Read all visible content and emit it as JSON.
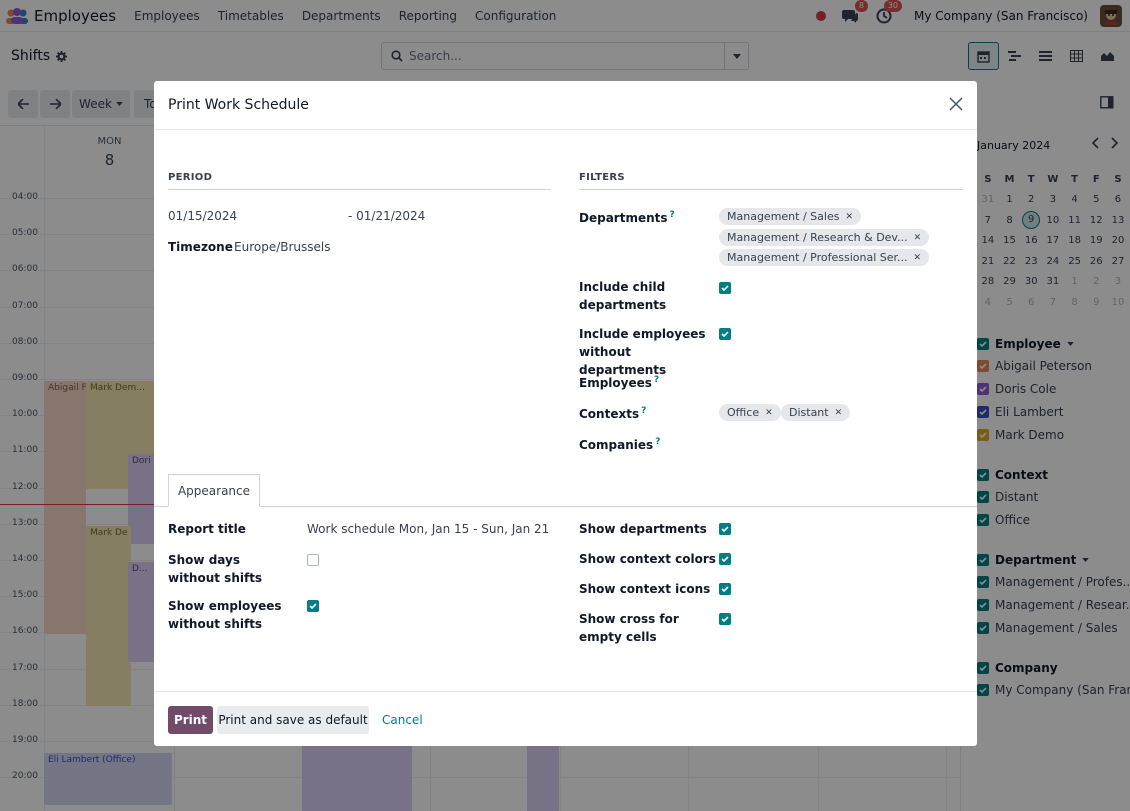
{
  "topbar": {
    "app_name": "Employees",
    "menu": [
      "Employees",
      "Timetables",
      "Departments",
      "Reporting",
      "Configuration"
    ],
    "messages_count": "8",
    "activities_count": "30",
    "company": "My Company (San Francisco)"
  },
  "control": {
    "breadcrumb": "Shifts",
    "search_placeholder": "Search..."
  },
  "toolbar": {
    "week_label": "Week",
    "today_label": "To"
  },
  "calendar": {
    "day_name": "MON",
    "day_num": "8",
    "hours": [
      "04:00",
      "05:00",
      "06:00",
      "07:00",
      "08:00",
      "09:00",
      "10:00",
      "11:00",
      "12:00",
      "13:00",
      "14:00",
      "15:00",
      "16:00",
      "17:00",
      "18:00",
      "19:00",
      "20:00"
    ],
    "events": [
      "Abigail F",
      "Mark Dem...",
      "Dori",
      "Mark De",
      "D...",
      "Eli Lambert (Office)"
    ]
  },
  "sidebar": {
    "month": "January 2024",
    "weekdays": [
      "S",
      "M",
      "T",
      "W",
      "T",
      "F",
      "S"
    ],
    "weeks": [
      [
        "31",
        "1",
        "2",
        "3",
        "4",
        "5",
        "6"
      ],
      [
        "7",
        "8",
        "9",
        "10",
        "11",
        "12",
        "13"
      ],
      [
        "14",
        "15",
        "16",
        "17",
        "18",
        "19",
        "20"
      ],
      [
        "21",
        "22",
        "23",
        "24",
        "25",
        "26",
        "27"
      ],
      [
        "28",
        "29",
        "30",
        "31",
        "1",
        "2",
        "3"
      ],
      [
        "4",
        "5",
        "6",
        "7",
        "8",
        "9",
        "10"
      ]
    ],
    "today": "9",
    "employee_title": "Employee",
    "employees": [
      {
        "name": "Abigail Peterson",
        "color": "#e8875a"
      },
      {
        "name": "Doris Cole",
        "color": "#8e5bd6"
      },
      {
        "name": "Eli Lambert",
        "color": "#3b4fc7"
      },
      {
        "name": "Mark Demo",
        "color": "#e0a92e"
      }
    ],
    "context_title": "Context",
    "contexts": [
      "Distant",
      "Office"
    ],
    "department_title": "Department",
    "departments": [
      "Management / Profes...",
      "Management / Resear...",
      "Management / Sales"
    ],
    "company_title": "Company",
    "companies": [
      "My Company (San Fran..."
    ]
  },
  "modal": {
    "title": "Print Work Schedule",
    "period_head": "PERIOD",
    "filters_head": "FILTERS",
    "date_from": "01/15/2024",
    "date_to": "- 01/21/2024",
    "timezone_label": "Timezone",
    "timezone_value": "Europe/Brussels",
    "departments_label": "Departments",
    "department_tags": [
      "Management / Sales",
      "Management / Research & Dev...",
      "Management / Professional Ser..."
    ],
    "include_child_label": "Include child departments",
    "include_no_dept_label": "Include employees without departments",
    "employees_label": "Employees",
    "contexts_label": "Contexts",
    "context_tags": [
      "Office",
      "Distant"
    ],
    "companies_label": "Companies",
    "help_mark": "?",
    "tab_appearance": "Appearance",
    "report_title_label": "Report title",
    "report_title_value": "Work schedule Mon, Jan 15 - Sun, Jan 21",
    "show_days_label": "Show days without shifts",
    "show_employees_label": "Show employees without shifts",
    "show_departments_label": "Show departments",
    "show_context_colors_label": "Show context colors",
    "show_context_icons_label": "Show context icons",
    "show_cross_label": "Show cross for empty cells",
    "print_btn": "Print",
    "print_default_btn": "Print and save as default",
    "cancel_btn": "Cancel"
  },
  "colors": {
    "accent": "#017e84",
    "primary": "#714b67"
  }
}
